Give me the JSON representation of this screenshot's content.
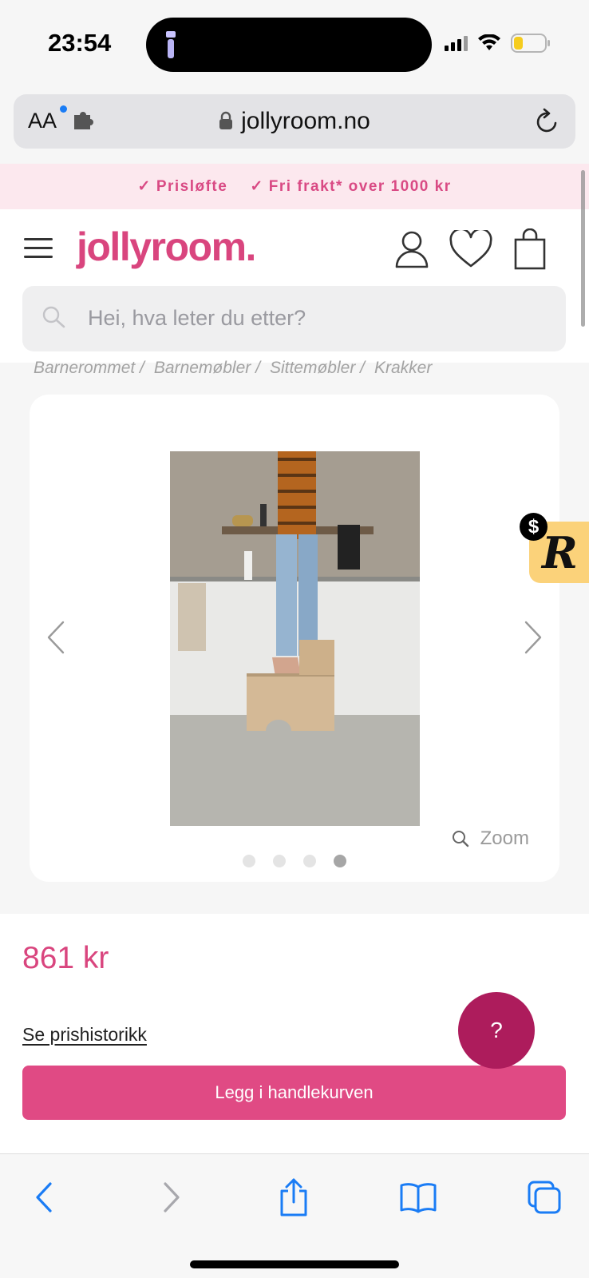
{
  "status_bar": {
    "time": "23:54"
  },
  "browser": {
    "aa_label": "AA",
    "url": "jollyroom.no"
  },
  "promo": [
    {
      "label": "Prisløfte"
    },
    {
      "label": "Fri frakt* over 1000 kr"
    }
  ],
  "header": {
    "logo": "jollyroom."
  },
  "search": {
    "placeholder": "Hei, hva leter du etter?"
  },
  "breadcrumb": [
    "Barnerommet",
    "Barnemøbler",
    "Sittemøbler",
    "Krakker"
  ],
  "gallery": {
    "zoom_label": "Zoom",
    "slide_count": 4,
    "active_slide": 4
  },
  "reward": {
    "coin": "$",
    "letter": "R"
  },
  "product": {
    "price": "861 kr",
    "history_link": "Se prishistorikk",
    "add_to_cart": "Legg i handlekurven"
  },
  "help": {
    "label": "?"
  },
  "colors": {
    "brand": "#d9457e",
    "brand_dark": "#ad1c5c",
    "promo_bg": "#fce8ee",
    "ios_blue": "#1a7cf5"
  }
}
